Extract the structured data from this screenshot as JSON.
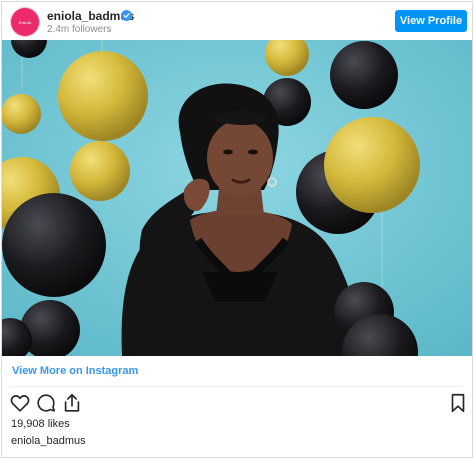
{
  "header": {
    "avatar_text": "Eniola",
    "username": "eniola_badmus",
    "followers": "2.4m followers",
    "view_profile_label": "View Profile"
  },
  "post": {
    "photo_alt": "",
    "view_more_label": "View More on Instagram",
    "likes": "19,908 likes",
    "caption_username": "eniola_badmus"
  },
  "icons": {
    "like": "heart-icon",
    "comment": "comment-icon",
    "share": "share-icon",
    "save": "bookmark-icon"
  },
  "colors": {
    "accent": "#0095f6",
    "link": "#3897f0",
    "photo_background": "#70c8d6",
    "gold_balloon": "#d4b83a",
    "black_balloon": "#1b1b1f"
  }
}
